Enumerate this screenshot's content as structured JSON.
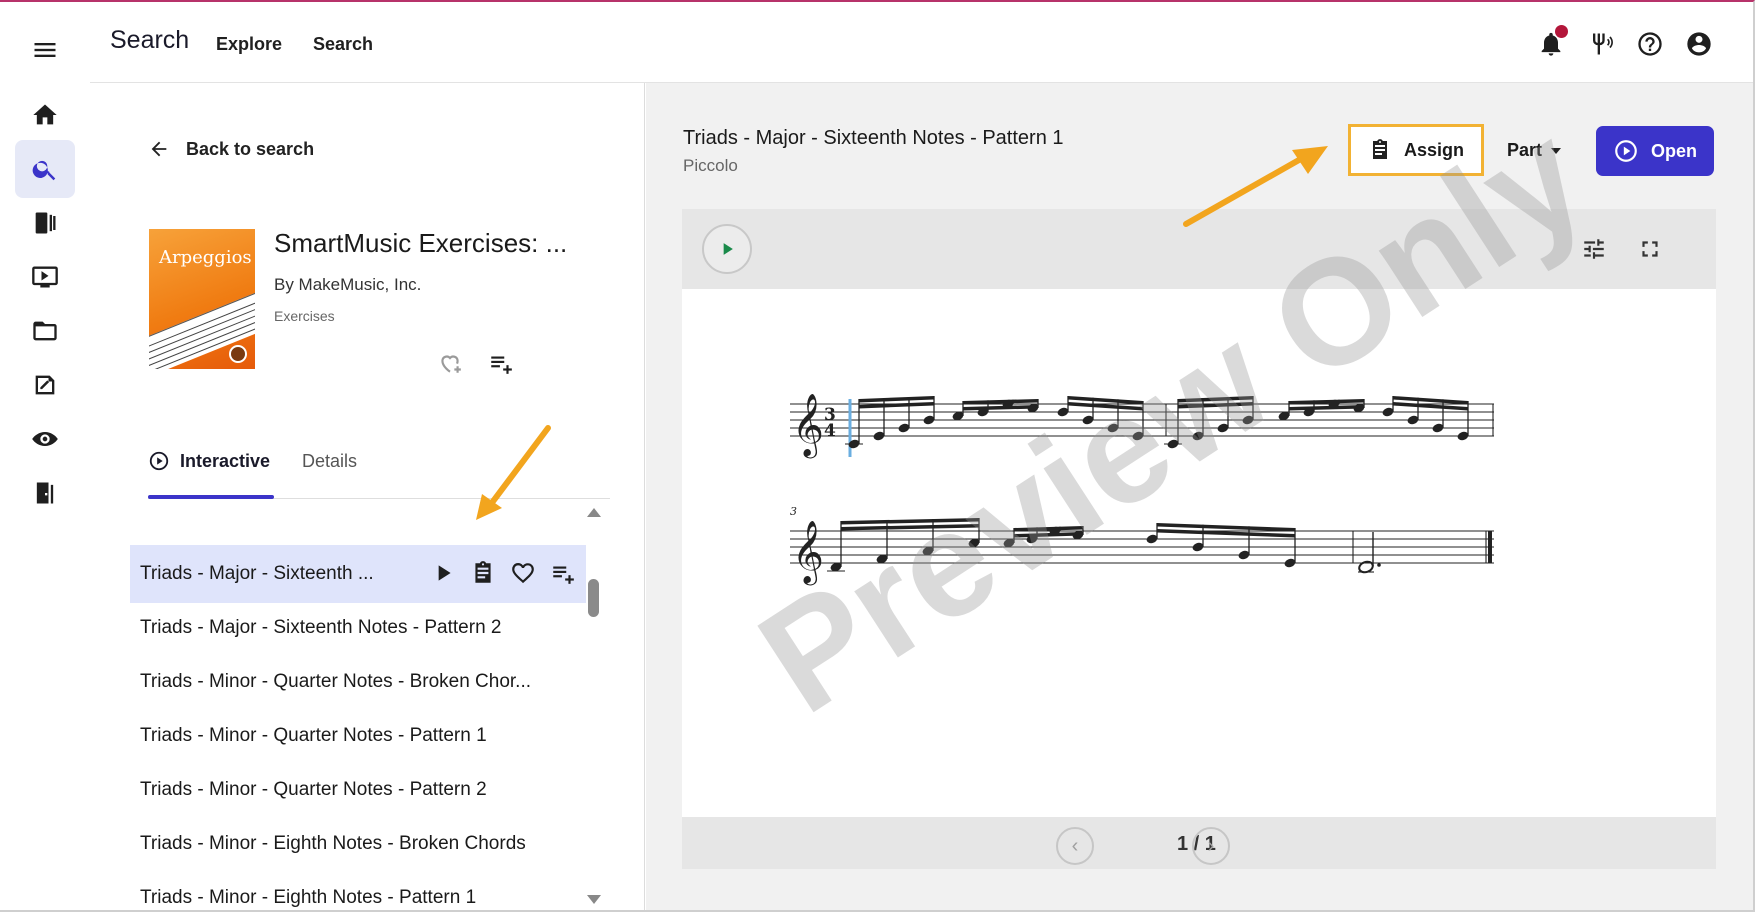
{
  "app": {
    "title": "Search",
    "nav": [
      "Explore",
      "Search"
    ]
  },
  "rail": {
    "items": [
      "menu-icon",
      "home-icon",
      "search-icon",
      "library-icon",
      "video-icon",
      "folder-icon",
      "assignments-icon",
      "ensemble-icon",
      "door-icon"
    ],
    "active": "search-icon"
  },
  "topbar_icons": [
    "bell-icon",
    "tuner-icon",
    "help-icon",
    "account-icon"
  ],
  "left": {
    "back_label": "Back to search",
    "book": {
      "cover_text": "Arpeggios",
      "title": "SmartMusic Exercises: ...",
      "author": "By MakeMusic, Inc.",
      "category": "Exercises"
    },
    "tabs": [
      "Interactive",
      "Details"
    ],
    "active_tab": "Interactive",
    "items": [
      "Triads - Major - Sixteenth ...",
      "Triads - Major - Sixteenth Notes - Pattern 2",
      "Triads - Minor - Quarter Notes - Broken Chor...",
      "Triads - Minor - Quarter Notes - Pattern 1",
      "Triads - Minor - Quarter Notes - Pattern 2",
      "Triads - Minor - Eighth Notes - Broken Chords",
      "Triads - Minor - Eighth Notes - Pattern 1"
    ]
  },
  "right": {
    "title": "Triads - Major - Sixteenth Notes - Pattern 1",
    "instrument": "Piccolo",
    "assign_label": "Assign",
    "part_label": "Part",
    "open_label": "Open",
    "measure_number": "3",
    "time_signature": {
      "top": "3",
      "bottom": "4"
    },
    "page_indicator": "1 / 1",
    "watermark": "Preview Only"
  },
  "colors": {
    "accent": "#3b34c9",
    "highlight": "#f2b233",
    "selected_row": "#dfe4fb",
    "play_green": "#1a8a4a"
  }
}
